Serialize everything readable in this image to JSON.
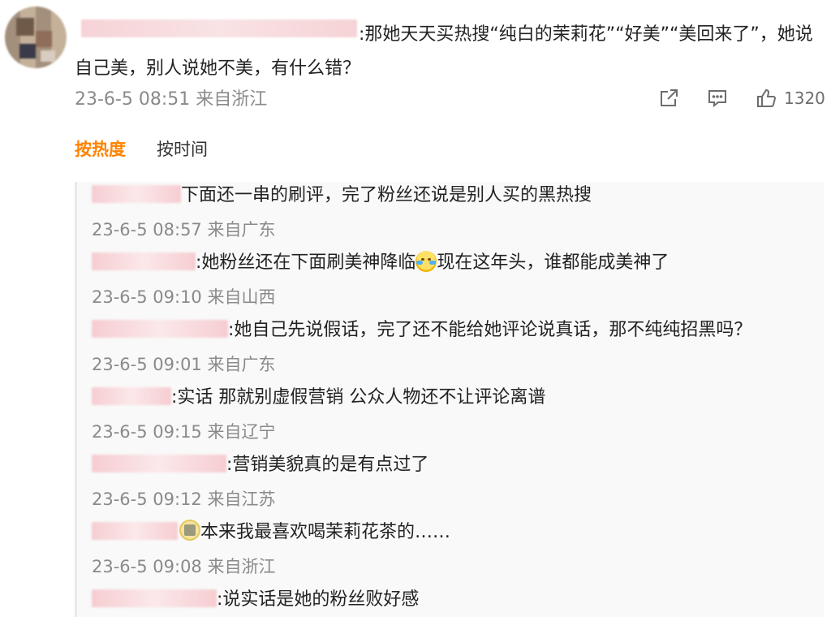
{
  "comment": {
    "text": ":那她天天买热搜“纯白的茉莉花”“好美”“美回来了”，她说自己美，别人说她不美，有什么错？",
    "time": "23-6-5 08:51 来自浙江",
    "actions": {
      "share_icon": "share-icon",
      "reply_icon": "comment-icon",
      "like_icon": "thumbs-up-icon",
      "like_count": "1320"
    }
  },
  "sort": {
    "hot_label": "按热度",
    "time_label": "按时间"
  },
  "replies": [
    {
      "text": "下面还一串的刷评，完了粉丝还说是别人买的黑热搜",
      "time": "23-6-5 08:57 来自广东"
    },
    {
      "text_before": ":她粉丝还在下面刷美神降临",
      "text_after": "现在这年头，谁都能成美神了",
      "time": "23-6-5 09:10 来自山西",
      "emoji": "crying-laughing-emoji"
    },
    {
      "text": ":她自己先说假话，完了还不能给她评论说真话，那不纯纯招黑吗？",
      "time": "23-6-5 09:01 来自广东"
    },
    {
      "text": ":实话 那就别虚假营销 公众人物还不让评论离谱",
      "time": "23-6-5 09:15 来自辽宁"
    },
    {
      "text": ":营销美貌真的是有点过了",
      "time": "23-6-5 09:12 来自江苏"
    },
    {
      "text": "本来我最喜欢喝茉莉花茶的……",
      "time": "23-6-5 09:08 来自浙江",
      "emoji": "tea-emoji"
    },
    {
      "text": ":说实话是她的粉丝败好感",
      "time": ""
    }
  ],
  "colors": {
    "accent": "#ff8200",
    "meta": "#8a8a8a",
    "reply_bg": "#f9f9f9"
  }
}
